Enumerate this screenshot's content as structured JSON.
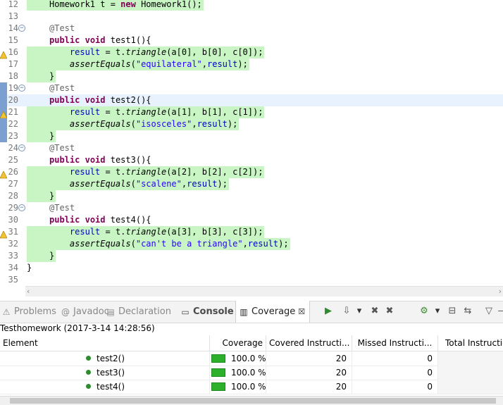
{
  "editor": {
    "lines": [
      {
        "num": "12",
        "code": [
          {
            "t": "Homework1 t = "
          },
          {
            "t": "new",
            "c": "kw"
          },
          {
            "t": " Homework1();"
          }
        ],
        "cov": true
      },
      {
        "num": "13",
        "code": []
      },
      {
        "num": "14",
        "code": [
          {
            "t": "@Test",
            "c": "an"
          }
        ],
        "fold": true
      },
      {
        "num": "15",
        "code": [
          {
            "t": "public",
            "c": "kw"
          },
          {
            "t": " "
          },
          {
            "t": "void",
            "c": "kw"
          },
          {
            "t": " test1(){"
          }
        ]
      },
      {
        "num": "16",
        "code": [
          {
            "t": "    "
          },
          {
            "t": "result",
            "c": "fld"
          },
          {
            "t": " = t."
          },
          {
            "t": "triangle",
            "c": "it"
          },
          {
            "t": "(a[0], b[0], c[0]);"
          }
        ],
        "cov": true,
        "warn": true
      },
      {
        "num": "17",
        "code": [
          {
            "t": "    "
          },
          {
            "t": "assertEquals",
            "c": "it"
          },
          {
            "t": "("
          },
          {
            "t": "\"equilateral\"",
            "c": "str"
          },
          {
            "t": ","
          },
          {
            "t": "result",
            "c": "fld"
          },
          {
            "t": ");"
          }
        ],
        "cov": true
      },
      {
        "num": "18",
        "code": [
          {
            "t": "}"
          }
        ],
        "cov": true
      },
      {
        "num": "19",
        "code": [
          {
            "t": "@Test",
            "c": "an"
          }
        ],
        "fold": true,
        "marker": true
      },
      {
        "num": "20",
        "code": [
          {
            "t": "public",
            "c": "kw"
          },
          {
            "t": " "
          },
          {
            "t": "void",
            "c": "kw"
          },
          {
            "t": " test2(){"
          }
        ],
        "cur": true,
        "marker": true
      },
      {
        "num": "21",
        "code": [
          {
            "t": "    "
          },
          {
            "t": "result",
            "c": "fld"
          },
          {
            "t": " = t."
          },
          {
            "t": "triangle",
            "c": "it"
          },
          {
            "t": "(a[1], b[1], c[1]);"
          }
        ],
        "cov": true,
        "warn": true,
        "marker": true
      },
      {
        "num": "22",
        "code": [
          {
            "t": "    "
          },
          {
            "t": "assertEquals",
            "c": "it"
          },
          {
            "t": "("
          },
          {
            "t": "\"isosceles\"",
            "c": "str"
          },
          {
            "t": ","
          },
          {
            "t": "result",
            "c": "fld"
          },
          {
            "t": ");"
          }
        ],
        "cov": true,
        "marker": true
      },
      {
        "num": "23",
        "code": [
          {
            "t": "}"
          }
        ],
        "cov": true,
        "marker": true
      },
      {
        "num": "24",
        "code": [
          {
            "t": "@Test",
            "c": "an"
          }
        ],
        "fold": true
      },
      {
        "num": "25",
        "code": [
          {
            "t": "public",
            "c": "kw"
          },
          {
            "t": " "
          },
          {
            "t": "void",
            "c": "kw"
          },
          {
            "t": " test3(){"
          }
        ]
      },
      {
        "num": "26",
        "code": [
          {
            "t": "    "
          },
          {
            "t": "result",
            "c": "fld"
          },
          {
            "t": " = t."
          },
          {
            "t": "triangle",
            "c": "it"
          },
          {
            "t": "(a[2], b[2], c[2]);"
          }
        ],
        "cov": true,
        "warn": true
      },
      {
        "num": "27",
        "code": [
          {
            "t": "    "
          },
          {
            "t": "assertEquals",
            "c": "it"
          },
          {
            "t": "("
          },
          {
            "t": "\"scalene\"",
            "c": "str"
          },
          {
            "t": ","
          },
          {
            "t": "result",
            "c": "fld"
          },
          {
            "t": ");"
          }
        ],
        "cov": true
      },
      {
        "num": "28",
        "code": [
          {
            "t": "}"
          }
        ],
        "cov": true
      },
      {
        "num": "29",
        "code": [
          {
            "t": "@Test",
            "c": "an"
          }
        ],
        "fold": true
      },
      {
        "num": "30",
        "code": [
          {
            "t": "public",
            "c": "kw"
          },
          {
            "t": " "
          },
          {
            "t": "void",
            "c": "kw"
          },
          {
            "t": " test4(){"
          }
        ]
      },
      {
        "num": "31",
        "code": [
          {
            "t": "    "
          },
          {
            "t": "result",
            "c": "fld"
          },
          {
            "t": " = t."
          },
          {
            "t": "triangle",
            "c": "it"
          },
          {
            "t": "(a[3], b[3], c[3]);"
          }
        ],
        "cov": true,
        "warn": true
      },
      {
        "num": "32",
        "code": [
          {
            "t": "    "
          },
          {
            "t": "assertEquals",
            "c": "it"
          },
          {
            "t": "("
          },
          {
            "t": "\"can't be a triangle\"",
            "c": "str"
          },
          {
            "t": ","
          },
          {
            "t": "result",
            "c": "fld"
          },
          {
            "t": ");"
          }
        ],
        "cov": true
      },
      {
        "num": "33",
        "code": [
          {
            "t": "}"
          }
        ],
        "cov": true
      },
      {
        "num": "34",
        "code": [
          {
            "t": "}"
          }
        ],
        "outdent": true
      },
      {
        "num": "35",
        "code": []
      }
    ]
  },
  "tabs": [
    {
      "label": "Problems",
      "icon": "problems-icon",
      "glyph": "⚠"
    },
    {
      "label": "Javadoc",
      "icon": "javadoc-icon",
      "glyph": "@"
    },
    {
      "label": "Declaration",
      "icon": "declaration-icon",
      "glyph": "▤"
    },
    {
      "label": "Console",
      "icon": "console-icon",
      "glyph": "▭"
    },
    {
      "label": "Coverage",
      "icon": "coverage-icon",
      "glyph": "▥",
      "close": "☒"
    }
  ],
  "toolbar": [
    {
      "icon": "relaunch-icon",
      "glyph": "▶"
    },
    {
      "icon": "dump-execution-data-icon",
      "glyph": "⇩"
    },
    {
      "icon": "dropdown-icon",
      "glyph": "▾"
    },
    {
      "icon": "remove-session-icon",
      "glyph": "✖"
    },
    {
      "icon": "remove-all-sessions-icon",
      "glyph": "✖"
    },
    {
      "icon": "merge-sessions-icon",
      "glyph": "⚙"
    },
    {
      "icon": "dropdown-icon",
      "glyph": "▾"
    },
    {
      "icon": "collapse-all-icon",
      "glyph": "⊟"
    },
    {
      "icon": "link-with-editor-icon",
      "glyph": "⇆"
    },
    {
      "icon": "view-menu-icon",
      "glyph": "▽"
    },
    {
      "icon": "minimize-icon",
      "glyph": "—"
    }
  ],
  "coverage": {
    "session": "Testhomework (2017-3-14 14:28:56)",
    "columns": [
      "Element",
      "Coverage",
      "Covered Instructi...",
      "Missed Instructi...",
      "Total Instructio"
    ],
    "rows": [
      {
        "element": "test2()",
        "coverage": "100.0 %",
        "covered": "20",
        "missed": "0",
        "total": "",
        "fraction": 1.0
      },
      {
        "element": "test3()",
        "coverage": "100.0 %",
        "covered": "20",
        "missed": "0",
        "total": "",
        "fraction": 1.0
      },
      {
        "element": "test4()",
        "coverage": "100.0 %",
        "covered": "20",
        "missed": "0",
        "total": "",
        "fraction": 1.0
      }
    ]
  },
  "colors": {
    "covered": "#c8f5c3",
    "keyword": "#7f0055",
    "string": "#2a00ff",
    "field": "#0000c0",
    "annotation": "#646464",
    "current_line": "#e8f2fe"
  }
}
